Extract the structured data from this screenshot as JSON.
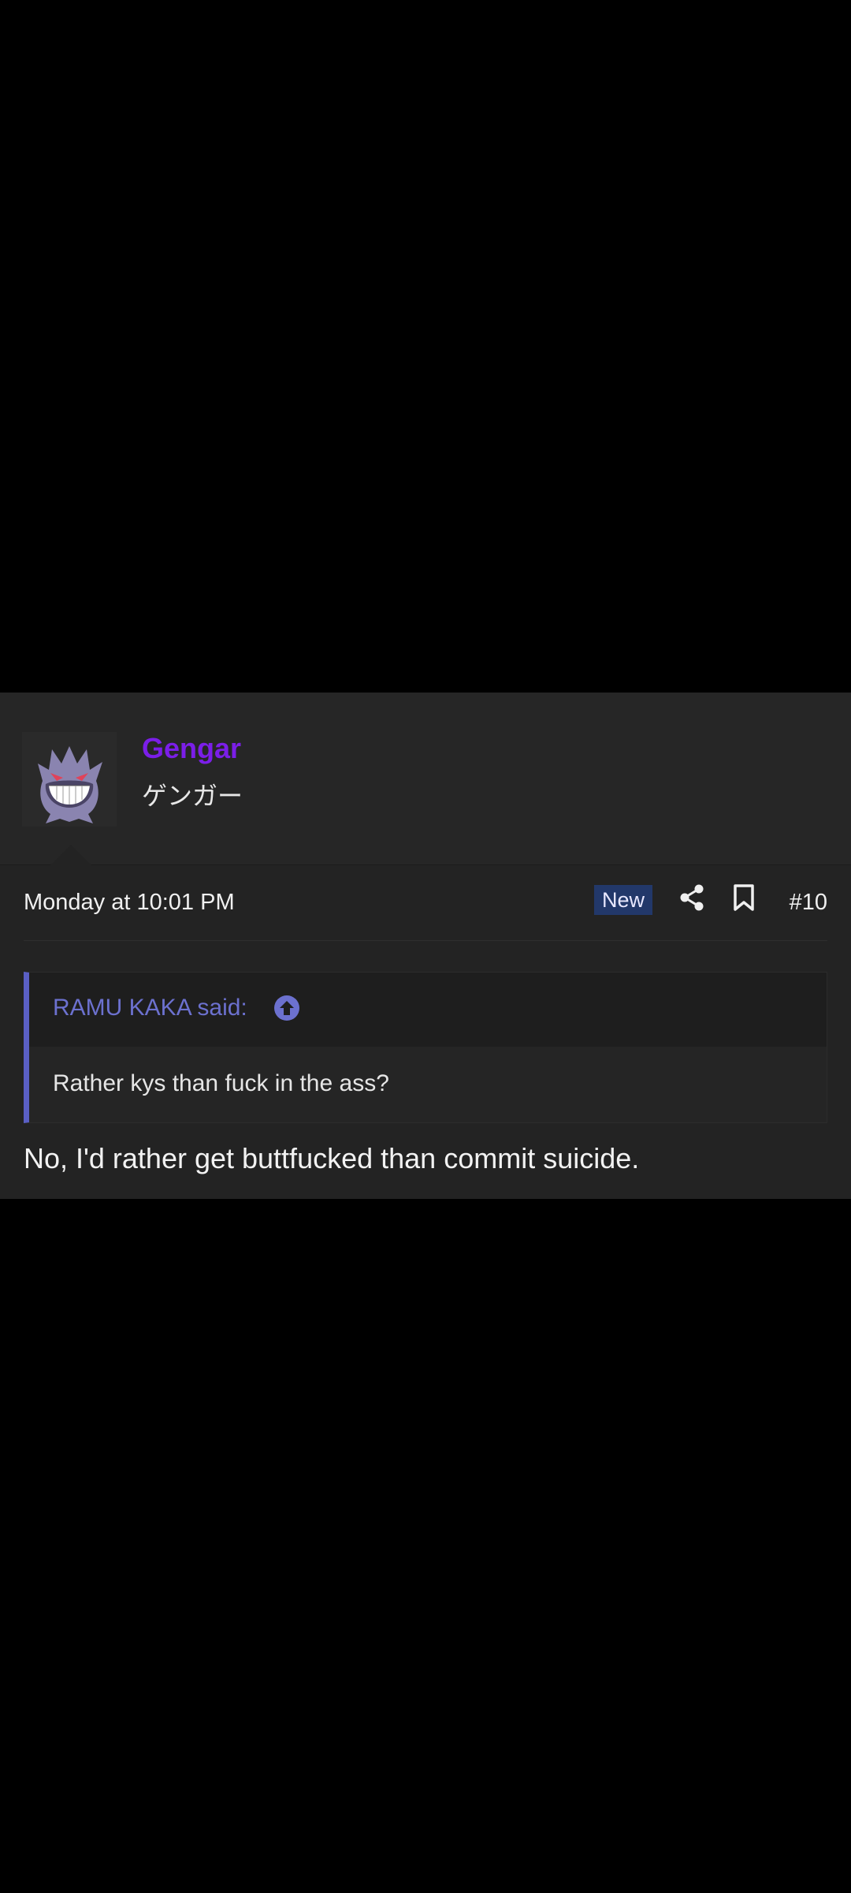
{
  "post": {
    "username": "Gengar",
    "user_title": "ゲンガー",
    "timestamp": "Monday at 10:01 PM",
    "badge": "New",
    "post_number": "#10",
    "quote": {
      "author": "RAMU KAKA said:",
      "text": "Rather kys than fuck in the ass?"
    },
    "reply": "No, I'd rather get buttfucked than commit suicide.",
    "icons": {
      "share": "share-icon",
      "bookmark": "bookmark-icon",
      "quote_jump": "arrow-up-circle-icon",
      "avatar": "gengar-avatar"
    }
  },
  "colors": {
    "username": "#7b1ee8",
    "quote_accent": "#5a5fc4",
    "badge_bg": "#22386a"
  }
}
